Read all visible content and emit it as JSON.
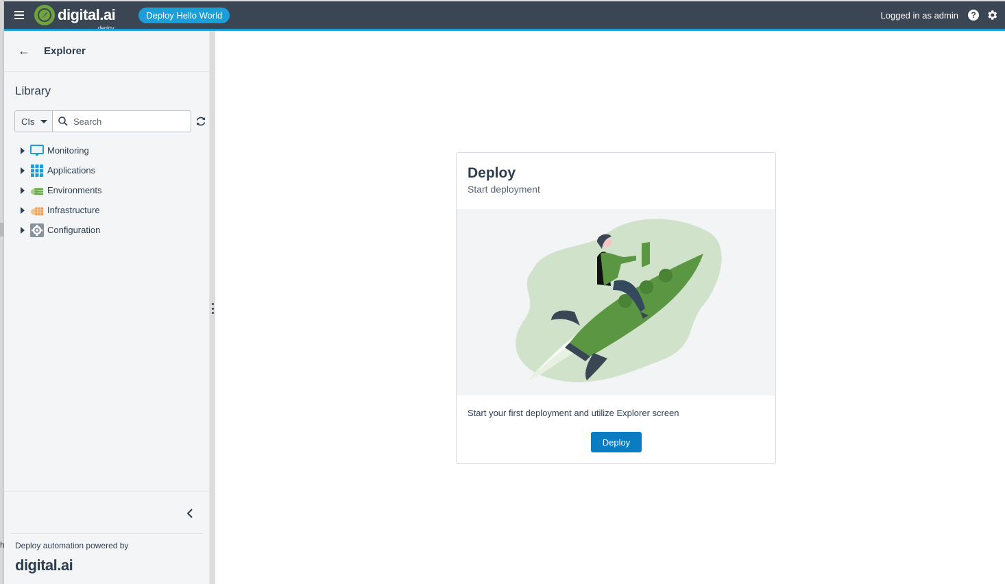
{
  "header": {
    "logo_text": "digital.ai",
    "logo_sub": "deploy",
    "app_badge": "Deploy Hello World",
    "user_text": "Logged in as admin",
    "help_glyph": "?",
    "accent_color": "#1a9fd8",
    "bar_color": "#3b4654"
  },
  "sidebar": {
    "back_icon": "arrow-left-icon",
    "explorer_title": "Explorer",
    "library_title": "Library",
    "ci_select": "CIs",
    "search_placeholder": "Search",
    "tree": [
      {
        "label": "Monitoring",
        "icon": "monitor-icon"
      },
      {
        "label": "Applications",
        "icon": "grid-icon"
      },
      {
        "label": "Environments",
        "icon": "cloud-stack-icon"
      },
      {
        "label": "Infrastructure",
        "icon": "cloud-server-icon"
      },
      {
        "label": "Configuration",
        "icon": "gear-box-icon"
      }
    ],
    "powered_text": "Deploy automation powered by",
    "footer_logo": "digital.ai"
  },
  "card": {
    "title": "Deploy",
    "subtitle": "Start deployment",
    "description": "Start your first deployment and utilize Explorer screen",
    "button_label": "Deploy",
    "button_color": "#0a7cc1"
  },
  "edge": {
    "letter": "h"
  }
}
